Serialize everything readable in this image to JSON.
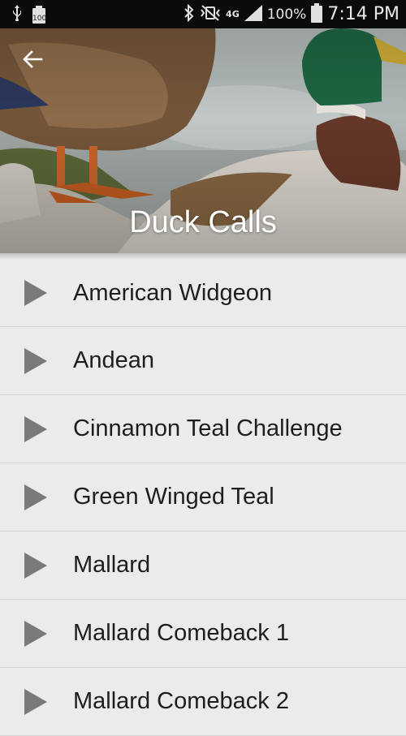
{
  "status_bar": {
    "battery_small": "100",
    "network_type": "4G",
    "battery_percent": "100%",
    "time": "7:14 PM"
  },
  "header": {
    "title": "Duck Calls"
  },
  "calls": [
    {
      "label": "American Widgeon"
    },
    {
      "label": "Andean"
    },
    {
      "label": "Cinnamon Teal Challenge"
    },
    {
      "label": "Green Winged Teal"
    },
    {
      "label": "Mallard"
    },
    {
      "label": "Mallard Comeback 1"
    },
    {
      "label": "Mallard Comeback 2"
    }
  ]
}
